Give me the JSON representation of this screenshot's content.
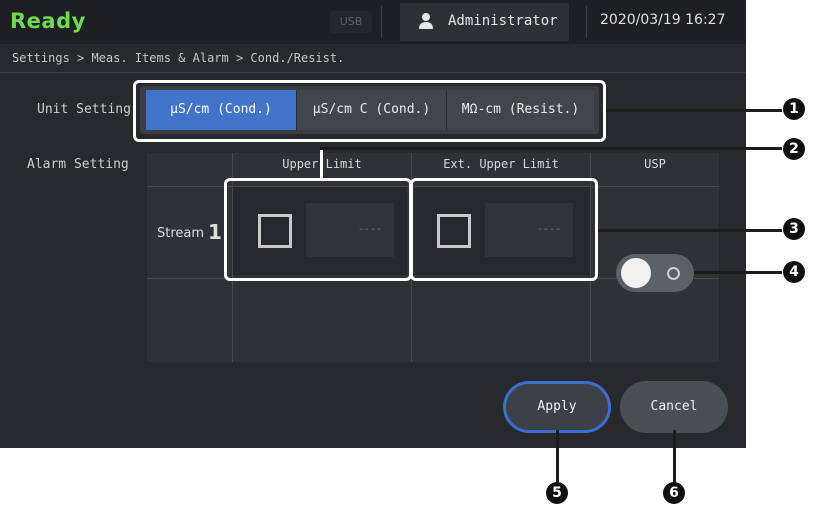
{
  "topbar": {
    "status": "Ready",
    "usb_label": "USB",
    "user_icon": "person-icon",
    "user_name": "Administrator",
    "datetime": "2020/03/19 16:27"
  },
  "breadcrumb": "Settings > Meas. Items & Alarm > Cond./Resist.",
  "unit_setting": {
    "label": "Unit Setting",
    "options": [
      "μS/cm (Cond.)",
      "μS/cm C (Cond.)",
      "MΩ-cm (Resist.)"
    ],
    "selected": "μS/cm (Cond.)"
  },
  "alarm_setting": {
    "label": "Alarm Setting",
    "columns": [
      "Upper Limit",
      "Ext. Upper Limit",
      "USP"
    ],
    "row_label": "Stream",
    "row_number": "1",
    "upper_limit_value": "----",
    "ext_upper_limit_value": "----",
    "usp_toggle": "off"
  },
  "buttons": {
    "apply": "Apply",
    "cancel": "Cancel"
  },
  "callouts": [
    "1",
    "2",
    "3",
    "4",
    "5",
    "6"
  ],
  "colors": {
    "accent": "#3f74c8",
    "status_green": "#6fdb4f",
    "apply_border": "#3b6fd1"
  }
}
